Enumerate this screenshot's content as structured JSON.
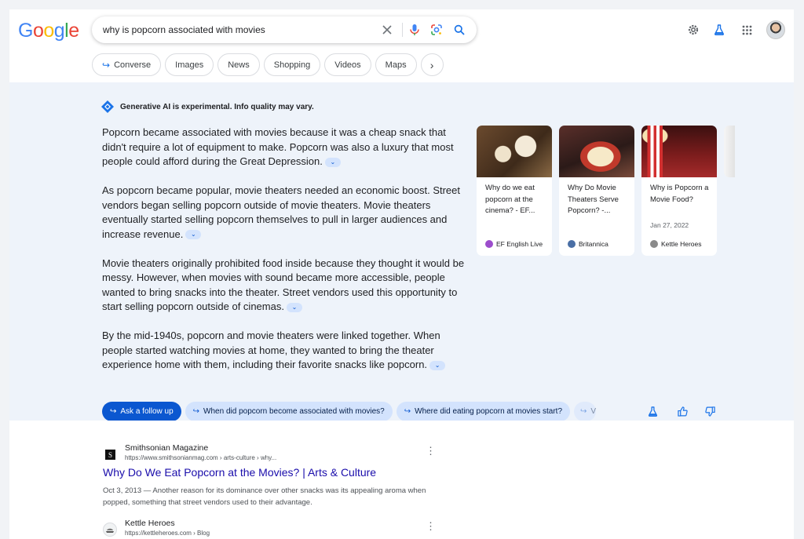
{
  "header": {
    "logo_letters": [
      "G",
      "o",
      "o",
      "g",
      "l",
      "e"
    ],
    "logo_colors": [
      "#4285f4",
      "#ea4335",
      "#fbbc05",
      "#4285f4",
      "#34a853",
      "#ea4335"
    ],
    "search_query": "why is popcorn associated with movies",
    "chips": [
      {
        "label": "Converse",
        "has_arrow": true
      },
      {
        "label": "Images"
      },
      {
        "label": "News"
      },
      {
        "label": "Shopping"
      },
      {
        "label": "Videos"
      },
      {
        "label": "Maps"
      }
    ],
    "icons": [
      "clear-icon",
      "mic-icon",
      "lens-icon",
      "search-icon",
      "settings-gear-icon",
      "labs-flask-icon",
      "apps-grid-icon",
      "avatar"
    ]
  },
  "ai_overview": {
    "badge": "Generative AI is experimental. Info quality may vary.",
    "paragraphs": [
      "Popcorn became associated with movies because it was a cheap snack that didn't require a lot of equipment to make. Popcorn was also a luxury that most people could afford during the Great Depression.",
      "As popcorn became popular, movie theaters needed an economic boost. Street vendors began selling popcorn outside of movie theaters. Movie theaters eventually started selling popcorn themselves to pull in larger audiences and increase revenue.",
      "Movie theaters originally prohibited food inside because they thought it would be messy. However, when movies with sound became more accessible, people wanted to bring snacks into the theater. Street vendors used this opportunity to start selling popcorn outside of cinemas.",
      "By the mid-1940s, popcorn and movie theaters were linked together. When people started watching movies at home, they wanted to bring the theater experience home with them, including their favorite snacks like popcorn."
    ],
    "expand_glyph": "⌄",
    "cards": [
      {
        "title": "Why do we eat popcorn at the cinema? - EF...",
        "date": "",
        "source": "EF English Live",
        "fav_color": "#9c4dcc",
        "thumb": "popcorn-spilled"
      },
      {
        "title": "Why Do Movie Theaters Serve Popcorn? -...",
        "date": "",
        "source": "Britannica",
        "fav_color": "#4a6fa5",
        "thumb": "popcorn-bowl"
      },
      {
        "title": "Why is Popcorn a Movie Food?",
        "date": "Jan 27, 2022",
        "source": "Kettle Heroes",
        "fav_color": "#8a8a8a",
        "thumb": "popcorn-cinema"
      }
    ],
    "followups": [
      {
        "label": "Ask a follow up",
        "primary": true
      },
      {
        "label": "When did popcorn become associated with movies?"
      },
      {
        "label": "Where did eating popcorn at movies start?"
      }
    ],
    "followup_fade_text": "V"
  },
  "results": [
    {
      "site_name": "Smithsonian Magazine",
      "url": "https://www.smithsonianmag.com › arts-culture › why...",
      "title": "Why Do We Eat Popcorn at the Movies? | Arts & Culture",
      "snippet": "Oct 3, 2013 — Another reason for its dominance over other snacks was its appealing aroma when popped, something that street vendors used to their advantage.",
      "favicon_letter": "S"
    },
    {
      "site_name": "Kettle Heroes",
      "url": "https://kettleheroes.com › Blog",
      "title": "",
      "snippet": "",
      "favicon_letter": ""
    }
  ]
}
